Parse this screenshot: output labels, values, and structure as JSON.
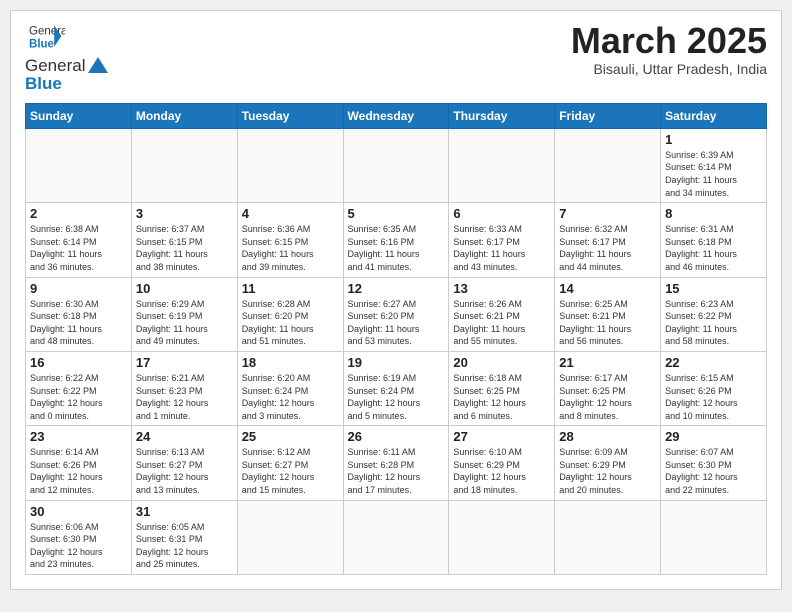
{
  "header": {
    "logo_general": "General",
    "logo_blue": "Blue",
    "month_title": "March 2025",
    "subtitle": "Bisauli, Uttar Pradesh, India"
  },
  "weekdays": [
    "Sunday",
    "Monday",
    "Tuesday",
    "Wednesday",
    "Thursday",
    "Friday",
    "Saturday"
  ],
  "weeks": [
    [
      {
        "day": "",
        "info": ""
      },
      {
        "day": "",
        "info": ""
      },
      {
        "day": "",
        "info": ""
      },
      {
        "day": "",
        "info": ""
      },
      {
        "day": "",
        "info": ""
      },
      {
        "day": "",
        "info": ""
      },
      {
        "day": "1",
        "info": "Sunrise: 6:39 AM\nSunset: 6:14 PM\nDaylight: 11 hours\nand 34 minutes."
      }
    ],
    [
      {
        "day": "2",
        "info": "Sunrise: 6:38 AM\nSunset: 6:14 PM\nDaylight: 11 hours\nand 36 minutes."
      },
      {
        "day": "3",
        "info": "Sunrise: 6:37 AM\nSunset: 6:15 PM\nDaylight: 11 hours\nand 38 minutes."
      },
      {
        "day": "4",
        "info": "Sunrise: 6:36 AM\nSunset: 6:15 PM\nDaylight: 11 hours\nand 39 minutes."
      },
      {
        "day": "5",
        "info": "Sunrise: 6:35 AM\nSunset: 6:16 PM\nDaylight: 11 hours\nand 41 minutes."
      },
      {
        "day": "6",
        "info": "Sunrise: 6:33 AM\nSunset: 6:17 PM\nDaylight: 11 hours\nand 43 minutes."
      },
      {
        "day": "7",
        "info": "Sunrise: 6:32 AM\nSunset: 6:17 PM\nDaylight: 11 hours\nand 44 minutes."
      },
      {
        "day": "8",
        "info": "Sunrise: 6:31 AM\nSunset: 6:18 PM\nDaylight: 11 hours\nand 46 minutes."
      }
    ],
    [
      {
        "day": "9",
        "info": "Sunrise: 6:30 AM\nSunset: 6:18 PM\nDaylight: 11 hours\nand 48 minutes."
      },
      {
        "day": "10",
        "info": "Sunrise: 6:29 AM\nSunset: 6:19 PM\nDaylight: 11 hours\nand 49 minutes."
      },
      {
        "day": "11",
        "info": "Sunrise: 6:28 AM\nSunset: 6:20 PM\nDaylight: 11 hours\nand 51 minutes."
      },
      {
        "day": "12",
        "info": "Sunrise: 6:27 AM\nSunset: 6:20 PM\nDaylight: 11 hours\nand 53 minutes."
      },
      {
        "day": "13",
        "info": "Sunrise: 6:26 AM\nSunset: 6:21 PM\nDaylight: 11 hours\nand 55 minutes."
      },
      {
        "day": "14",
        "info": "Sunrise: 6:25 AM\nSunset: 6:21 PM\nDaylight: 11 hours\nand 56 minutes."
      },
      {
        "day": "15",
        "info": "Sunrise: 6:23 AM\nSunset: 6:22 PM\nDaylight: 11 hours\nand 58 minutes."
      }
    ],
    [
      {
        "day": "16",
        "info": "Sunrise: 6:22 AM\nSunset: 6:22 PM\nDaylight: 12 hours\nand 0 minutes."
      },
      {
        "day": "17",
        "info": "Sunrise: 6:21 AM\nSunset: 6:23 PM\nDaylight: 12 hours\nand 1 minute."
      },
      {
        "day": "18",
        "info": "Sunrise: 6:20 AM\nSunset: 6:24 PM\nDaylight: 12 hours\nand 3 minutes."
      },
      {
        "day": "19",
        "info": "Sunrise: 6:19 AM\nSunset: 6:24 PM\nDaylight: 12 hours\nand 5 minutes."
      },
      {
        "day": "20",
        "info": "Sunrise: 6:18 AM\nSunset: 6:25 PM\nDaylight: 12 hours\nand 6 minutes."
      },
      {
        "day": "21",
        "info": "Sunrise: 6:17 AM\nSunset: 6:25 PM\nDaylight: 12 hours\nand 8 minutes."
      },
      {
        "day": "22",
        "info": "Sunrise: 6:15 AM\nSunset: 6:26 PM\nDaylight: 12 hours\nand 10 minutes."
      }
    ],
    [
      {
        "day": "23",
        "info": "Sunrise: 6:14 AM\nSunset: 6:26 PM\nDaylight: 12 hours\nand 12 minutes."
      },
      {
        "day": "24",
        "info": "Sunrise: 6:13 AM\nSunset: 6:27 PM\nDaylight: 12 hours\nand 13 minutes."
      },
      {
        "day": "25",
        "info": "Sunrise: 6:12 AM\nSunset: 6:27 PM\nDaylight: 12 hours\nand 15 minutes."
      },
      {
        "day": "26",
        "info": "Sunrise: 6:11 AM\nSunset: 6:28 PM\nDaylight: 12 hours\nand 17 minutes."
      },
      {
        "day": "27",
        "info": "Sunrise: 6:10 AM\nSunset: 6:29 PM\nDaylight: 12 hours\nand 18 minutes."
      },
      {
        "day": "28",
        "info": "Sunrise: 6:09 AM\nSunset: 6:29 PM\nDaylight: 12 hours\nand 20 minutes."
      },
      {
        "day": "29",
        "info": "Sunrise: 6:07 AM\nSunset: 6:30 PM\nDaylight: 12 hours\nand 22 minutes."
      }
    ],
    [
      {
        "day": "30",
        "info": "Sunrise: 6:06 AM\nSunset: 6:30 PM\nDaylight: 12 hours\nand 23 minutes."
      },
      {
        "day": "31",
        "info": "Sunrise: 6:05 AM\nSunset: 6:31 PM\nDaylight: 12 hours\nand 25 minutes."
      },
      {
        "day": "",
        "info": ""
      },
      {
        "day": "",
        "info": ""
      },
      {
        "day": "",
        "info": ""
      },
      {
        "day": "",
        "info": ""
      },
      {
        "day": "",
        "info": ""
      }
    ]
  ]
}
